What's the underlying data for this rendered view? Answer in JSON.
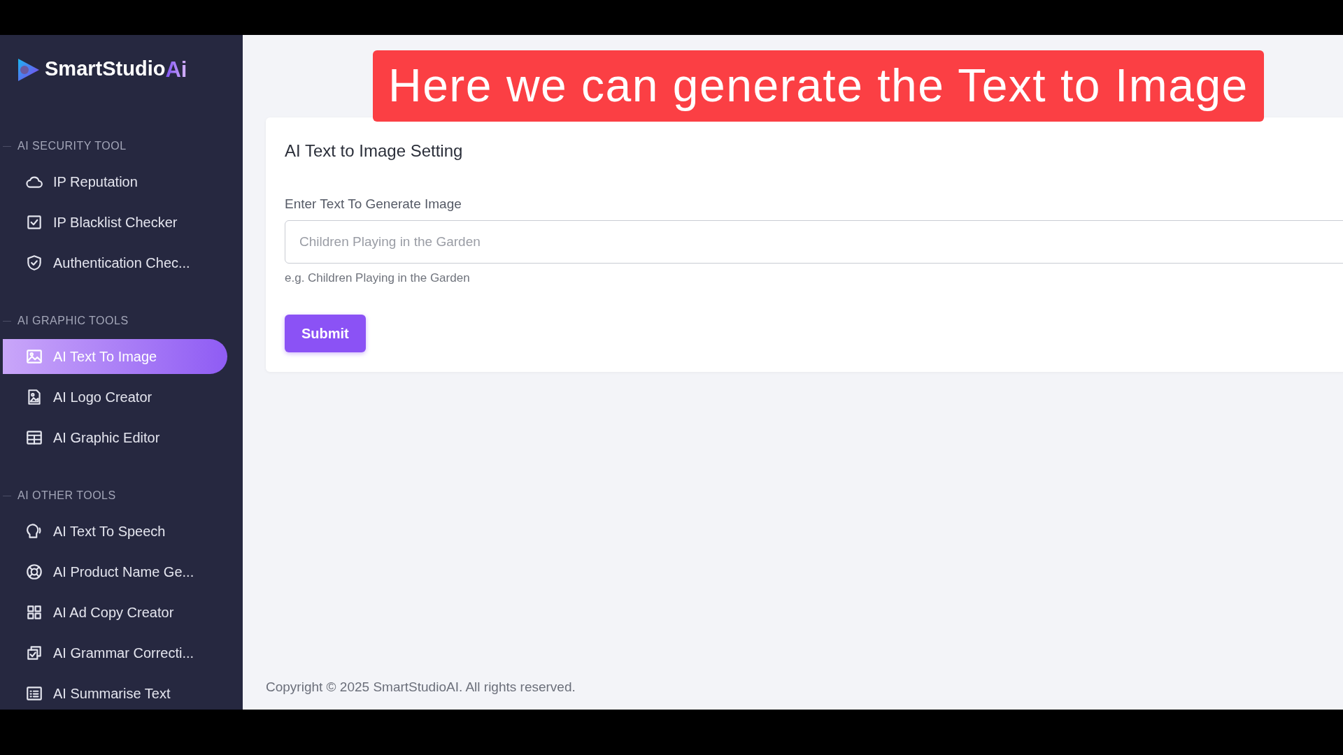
{
  "caption": "Here we can generate the Text to Image",
  "logo": {
    "text": "SmartStudio",
    "accent": "Ai"
  },
  "sidebar": {
    "sections": [
      {
        "title": "AI SECURITY TOOL",
        "items": [
          {
            "label": "IP Reputation",
            "selected": false
          },
          {
            "label": "IP Blacklist Checker",
            "selected": false
          },
          {
            "label": "Authentication Chec...",
            "selected": false
          }
        ]
      },
      {
        "title": "AI GRAPHIC TOOLS",
        "items": [
          {
            "label": "AI Text To Image",
            "selected": true
          },
          {
            "label": "AI Logo Creator",
            "selected": false
          },
          {
            "label": "AI Graphic Editor",
            "selected": false
          }
        ]
      },
      {
        "title": "AI OTHER TOOLS",
        "items": [
          {
            "label": "AI Text To Speech",
            "selected": false
          },
          {
            "label": "AI Product Name Ge...",
            "selected": false
          },
          {
            "label": "AI Ad Copy Creator",
            "selected": false
          },
          {
            "label": "AI Grammar Correcti...",
            "selected": false
          },
          {
            "label": "AI Summarise Text",
            "selected": false
          }
        ]
      }
    ]
  },
  "card": {
    "title": "AI Text to Image Setting",
    "field": {
      "label": "Enter Text To Generate Image",
      "placeholder": "Children Playing in the Garden",
      "help": "e.g. Children Playing in the Garden"
    },
    "button": "Submit"
  },
  "footer": "Copyright © 2025 SmartStudioAI. All rights reserved."
}
